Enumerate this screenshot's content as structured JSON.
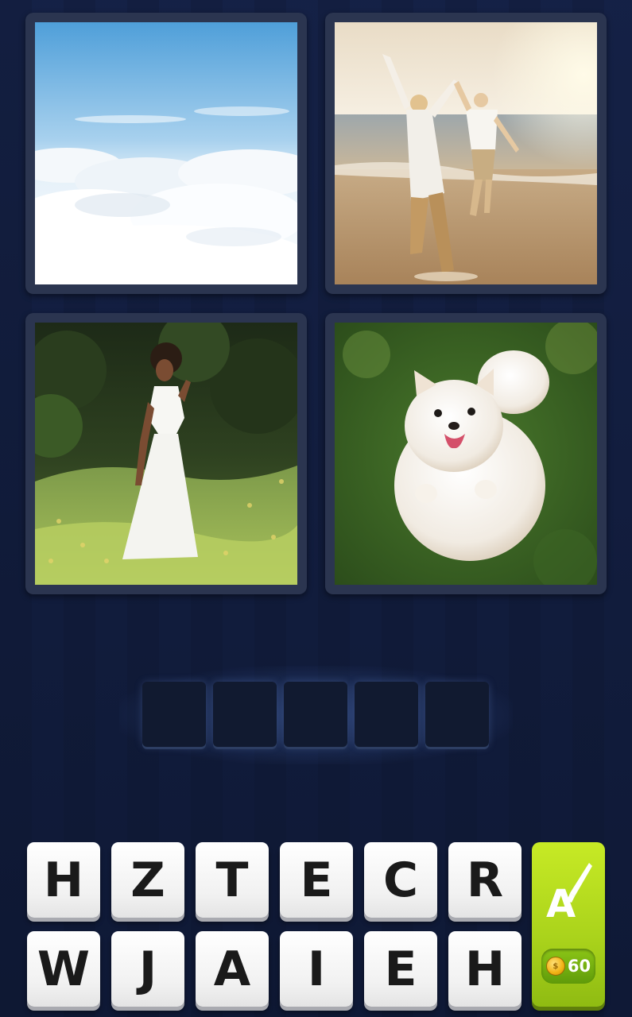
{
  "images": [
    {
      "id": "clouds",
      "subject": "sky-above-clouds"
    },
    {
      "id": "beach",
      "subject": "couple-dancing-on-beach"
    },
    {
      "id": "field",
      "subject": "woman-in-white-dress-in-meadow"
    },
    {
      "id": "dog",
      "subject": "white-pomeranian-jumping"
    }
  ],
  "answer": {
    "slots": [
      "",
      "",
      "",
      "",
      ""
    ]
  },
  "keyboard": {
    "row1": [
      "H",
      "Z",
      "T",
      "E",
      "C",
      "R"
    ],
    "row2": [
      "W",
      "J",
      "A",
      "I",
      "E",
      "H"
    ]
  },
  "hint": {
    "icon": "letter-reveal-brush-icon",
    "cost": "60",
    "coin_icon": "coin-icon"
  },
  "colors": {
    "background": "#142043",
    "hint_green": "#b5dc1f",
    "key_white": "#ffffff"
  }
}
